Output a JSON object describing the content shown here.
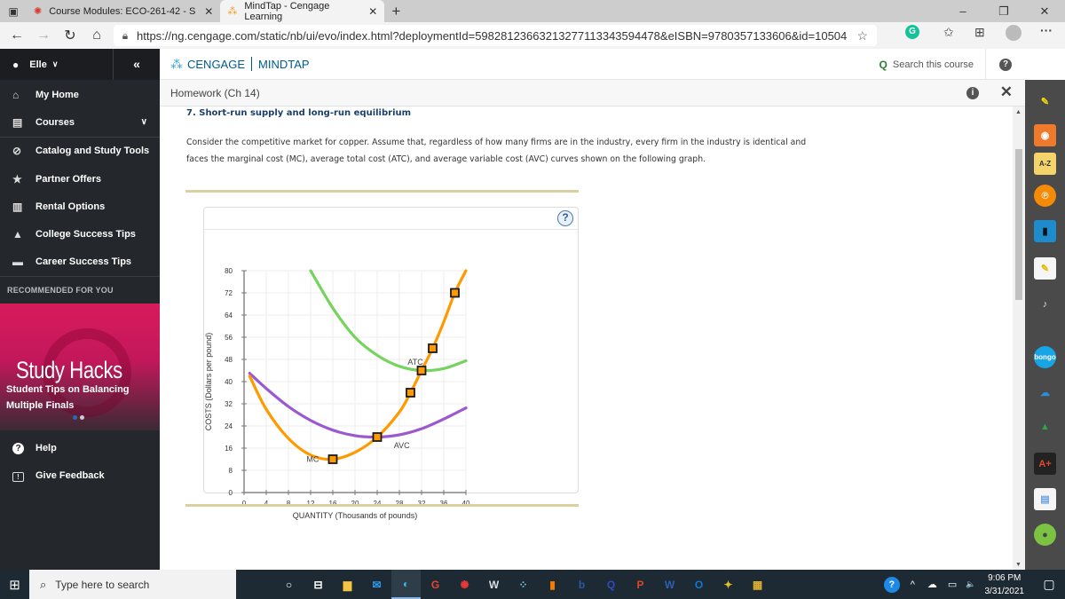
{
  "browser": {
    "tabs": [
      {
        "label": "Course Modules: ECO-261-42 - S",
        "active": false,
        "icon": "canvas-icon"
      },
      {
        "label": "MindTap - Cengage Learning",
        "active": true,
        "icon": "cengage-icon"
      }
    ],
    "new_tab": "+",
    "url": "https://ng.cengage.com/static/nb/ui/evo/index.html?deploymentId=59828123663213277113343594478&eISBN=9780357133606&id=105044...",
    "window_controls": {
      "minimize": "–",
      "maximize": "❐",
      "close": "✕"
    }
  },
  "sidebar": {
    "user": "Elle",
    "collapse": "«",
    "items": [
      {
        "label": "My Home",
        "icon": "home-icon",
        "glyph": "⌂"
      },
      {
        "label": "Courses",
        "icon": "book-icon",
        "glyph": "▤",
        "expandable": true
      },
      {
        "label": "Catalog and Study Tools",
        "icon": "compass-icon",
        "glyph": "⊘"
      },
      {
        "label": "Partner Offers",
        "icon": "star-icon",
        "glyph": "★"
      },
      {
        "label": "Rental Options",
        "icon": "open-book-icon",
        "glyph": "▥"
      },
      {
        "label": "College Success Tips",
        "icon": "graduation-cap-icon",
        "glyph": "🎓"
      },
      {
        "label": "Career Success Tips",
        "icon": "briefcase-icon",
        "glyph": "▬"
      }
    ],
    "recommended_heading": "RECOMMENDED FOR YOU",
    "promo": {
      "title": "Study Hacks",
      "subtitle_line1": "Student Tips on Balancing",
      "subtitle_line2": "Multiple Finals",
      "slides": 2,
      "active_slide": 1
    },
    "footer_items": [
      {
        "label": "Help",
        "icon": "help-circle-icon",
        "glyph": "?"
      },
      {
        "label": "Give Feedback",
        "icon": "feedback-icon",
        "glyph": "!"
      }
    ]
  },
  "header": {
    "brand": "CENGAGE",
    "product": "MINDTAP",
    "search_label": "Search this course",
    "help": "?"
  },
  "activity": {
    "title": "Homework (Ch 14)",
    "info": "i",
    "close": "✕",
    "question_title": "7. Short-run supply and long-run equilibrium",
    "prompt_line1": "Consider the competitive market for copper. Assume that, regardless of how many firms are in the industry, every firm in the industry is identical and",
    "prompt_line2": "faces the marginal cost (MC), average total cost (ATC), and average variable cost (AVC) curves shown on the following graph.",
    "graph_help": "?"
  },
  "chart_data": {
    "type": "line",
    "title": "",
    "xlabel": "QUANTITY (Thousands of pounds)",
    "ylabel": "COSTS (Dollars per pound)",
    "xlim": [
      0,
      40
    ],
    "ylim": [
      0,
      80
    ],
    "xticks": [
      0,
      4,
      8,
      12,
      16,
      20,
      24,
      28,
      32,
      36,
      40
    ],
    "yticks": [
      0,
      8,
      16,
      24,
      32,
      40,
      48,
      56,
      64,
      72,
      80
    ],
    "grid": true,
    "series": [
      {
        "name": "MC",
        "color": "#ff9900",
        "points": [
          [
            1,
            42
          ],
          [
            4,
            30
          ],
          [
            8,
            19.5
          ],
          [
            12,
            13.5
          ],
          [
            16,
            12
          ],
          [
            20,
            14.5
          ],
          [
            24,
            20
          ],
          [
            28,
            29
          ],
          [
            30,
            36
          ],
          [
            32,
            44
          ],
          [
            34,
            52
          ],
          [
            36,
            61.5
          ],
          [
            38,
            72
          ],
          [
            40,
            80
          ]
        ]
      },
      {
        "name": "AVC",
        "color": "#9b59d0",
        "points": [
          [
            1,
            43
          ],
          [
            4,
            37.5
          ],
          [
            8,
            31
          ],
          [
            12,
            26
          ],
          [
            16,
            22.5
          ],
          [
            20,
            20.5
          ],
          [
            24,
            20
          ],
          [
            28,
            20.8
          ],
          [
            32,
            23
          ],
          [
            36,
            26.5
          ],
          [
            40,
            30.5
          ]
        ]
      },
      {
        "name": "ATC",
        "color": "#77d35f",
        "points": [
          [
            12,
            80
          ],
          [
            16,
            66.5
          ],
          [
            20,
            56
          ],
          [
            24,
            49.5
          ],
          [
            28,
            45.5
          ],
          [
            32,
            44
          ],
          [
            36,
            44.7
          ],
          [
            40,
            47.5
          ]
        ]
      }
    ],
    "markers": [
      {
        "x": 16,
        "y": 12
      },
      {
        "x": 24,
        "y": 20
      },
      {
        "x": 30,
        "y": 36
      },
      {
        "x": 32,
        "y": 44
      },
      {
        "x": 34,
        "y": 52
      },
      {
        "x": 38,
        "y": 72
      }
    ],
    "curve_labels": [
      {
        "text": "MC",
        "x": 13.5,
        "y": 12
      },
      {
        "text": "AVC",
        "x": 27,
        "y": 17
      },
      {
        "text": "ATC",
        "x": 29.5,
        "y": 47
      }
    ]
  },
  "rail_icons": [
    {
      "name": "pen-highlighter-icon",
      "glyph": "✎",
      "bg": "transparent",
      "color": "#f5d90a"
    },
    {
      "name": "rss-icon",
      "glyph": "◉",
      "bg": "#f07a2c",
      "color": "#fff"
    },
    {
      "name": "glossary-az-icon",
      "glyph": "A-Z",
      "bg": "#f4d36a",
      "color": "#333"
    },
    {
      "name": "cengage-p-icon",
      "glyph": "℗",
      "bg": "#f58a07",
      "color": "#fff"
    },
    {
      "name": "ebook-icon",
      "glyph": "▮",
      "bg": "#1e8bcd",
      "color": "#111"
    },
    {
      "name": "notes-icon",
      "glyph": "✎",
      "bg": "#f5f5f5",
      "color": "#e6b800"
    },
    {
      "name": "readspeaker-icon",
      "glyph": "♪",
      "bg": "transparent",
      "color": "#ddd"
    },
    {
      "name": "bongo-icon",
      "glyph": "bongo",
      "bg": "#17a5e6",
      "color": "#fff"
    },
    {
      "name": "onedrive-icon",
      "glyph": "☁",
      "bg": "transparent",
      "color": "#2b8fd9"
    },
    {
      "name": "google-drive-icon",
      "glyph": "▲",
      "bg": "transparent",
      "color": "#2ea44f"
    },
    {
      "name": "aplus-icon",
      "glyph": "A+",
      "bg": "#222",
      "color": "#e04a2f"
    },
    {
      "name": "flashcards-icon",
      "glyph": "▤",
      "bg": "#f5f5f5",
      "color": "#6aa0e0"
    },
    {
      "name": "progress-icon",
      "glyph": "●",
      "bg": "#7cc243",
      "color": "#444"
    }
  ],
  "taskbar": {
    "search_placeholder": "Type here to search",
    "apps": [
      {
        "name": "cortana-icon",
        "glyph": "○"
      },
      {
        "name": "task-view-icon",
        "glyph": "⊟"
      },
      {
        "name": "file-explorer-icon",
        "glyph": "▆",
        "color": "#f4c542"
      },
      {
        "name": "mail-icon",
        "glyph": "✉",
        "color": "#2b9bf0"
      },
      {
        "name": "edge-icon",
        "glyph": "◐",
        "color": "#35c0e8",
        "active": true
      },
      {
        "name": "chrome-google-icon",
        "glyph": "G",
        "color": "#ea4335"
      },
      {
        "name": "canvas-icon",
        "glyph": "✺",
        "color": "#e53935"
      },
      {
        "name": "word-doc-icon",
        "glyph": "W",
        "color": "#ddd"
      },
      {
        "name": "cengage-app-icon",
        "glyph": "⁘",
        "color": "#7ec8e3"
      },
      {
        "name": "bookmark-app-icon",
        "glyph": "▮",
        "color": "#f57c00"
      },
      {
        "name": "b-app-icon",
        "glyph": "b",
        "color": "#2a5aa8"
      },
      {
        "name": "q-app-icon",
        "glyph": "Q",
        "color": "#2c4cc7"
      },
      {
        "name": "powerpoint-icon",
        "glyph": "P",
        "color": "#d9472b"
      },
      {
        "name": "word-icon",
        "glyph": "W",
        "color": "#2b5fb8"
      },
      {
        "name": "outlook-icon",
        "glyph": "O",
        "color": "#0f78d4"
      },
      {
        "name": "bird-app-icon",
        "glyph": "✦",
        "color": "#e0c020"
      },
      {
        "name": "tiger-app-icon",
        "glyph": "▦",
        "color": "#e0b030"
      }
    ],
    "tray": {
      "help": "?",
      "chevron": "^",
      "cloud": "☁",
      "battery": "▭",
      "volume": "🔈"
    },
    "time": "9:06 PM",
    "date": "3/31/2021",
    "notifications": "▢"
  }
}
